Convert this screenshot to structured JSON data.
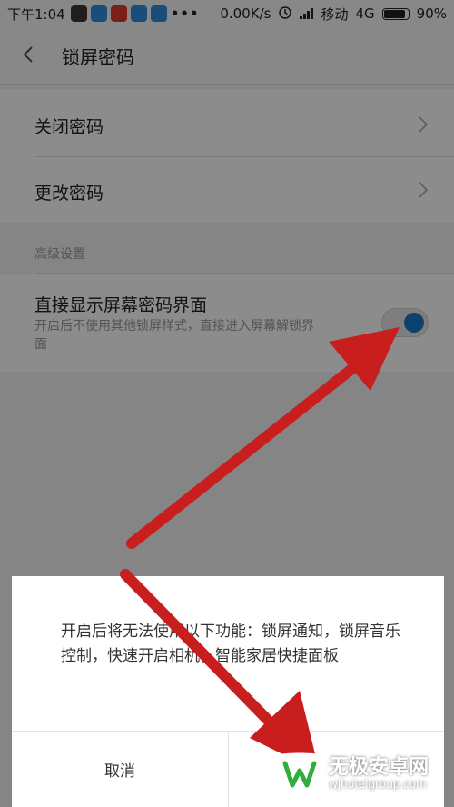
{
  "status_bar": {
    "time": "下午1:04",
    "apps": [
      {
        "name": "qq-icon",
        "color": "#3a3a3a"
      },
      {
        "name": "app-icon-1",
        "color": "#2f8fe0"
      },
      {
        "name": "app-icon-2",
        "color": "#e03a2f"
      },
      {
        "name": "app-icon-3",
        "color": "#2f8fe0"
      },
      {
        "name": "app-icon-4",
        "color": "#2f8fe0"
      }
    ],
    "more": "•••",
    "network_speed": "0.00K/s",
    "carrier": "移动",
    "network_type": "4G",
    "battery": "90%"
  },
  "header": {
    "title": "锁屏密码"
  },
  "menu": {
    "close_password": "关闭密码",
    "change_password": "更改密码"
  },
  "advanced": {
    "section_title": "高级设置",
    "direct_title": "直接显示屏幕密码界面",
    "direct_desc_line1": "开启后不使用其他锁屏样式，直接进入屏幕解锁界",
    "direct_desc_line2": "面"
  },
  "dialog": {
    "message": "开启后将无法使用以下功能：锁屏通知，锁屏音乐控制，快速开启相机，智能家居快捷面板",
    "cancel": "取消"
  },
  "watermark": {
    "name": "无极安卓网",
    "url": "wjhotelgroup.com"
  },
  "colors": {
    "accent_blue": "#1a78c8",
    "arrow_red": "#c81e1e",
    "logo_green": "#2fae3c"
  }
}
